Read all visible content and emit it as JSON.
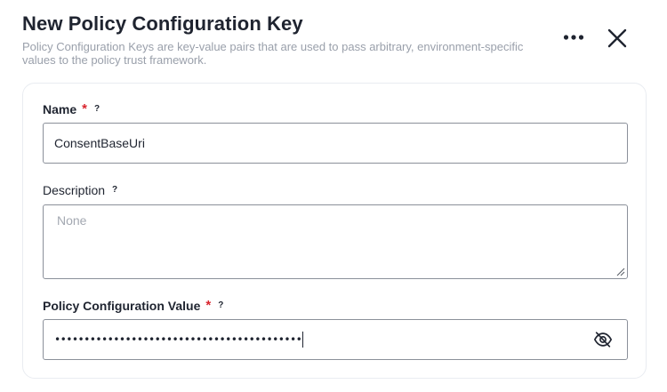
{
  "dialog": {
    "title": "New Policy Configuration Key",
    "subtitle_line1": "Policy Configuration Keys are key-value pairs that are used to pass arbitrary, environment-specific",
    "subtitle_line2": "values to the policy trust framework."
  },
  "icons": {
    "more": "more-horizontal-icon",
    "close": "close-icon",
    "help": "help-icon",
    "visibility": "eye-off-icon",
    "resize": "resize-handle-icon"
  },
  "form": {
    "name": {
      "label": "Name",
      "required_mark": "*",
      "help": "?",
      "value": "ConsentBaseUri"
    },
    "description": {
      "label": "Description",
      "help": "?",
      "placeholder": "None"
    },
    "config_value": {
      "label": "Policy Configuration Value",
      "required_mark": "*",
      "help": "?",
      "masked_value": "••••••••••••••••••••••••••••••••••••••••••"
    }
  },
  "colors": {
    "text": "#1f2430",
    "muted": "#9aa0ab",
    "required": "#d9252e",
    "border": "#8b909a",
    "card_border": "#e9ecf1"
  }
}
